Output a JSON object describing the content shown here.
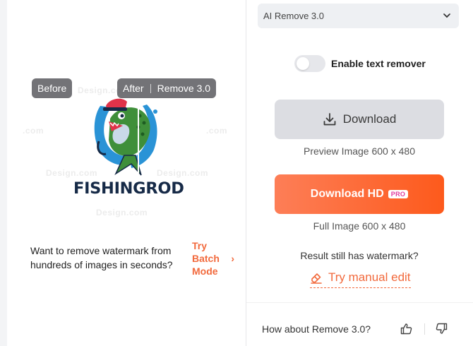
{
  "left": {
    "labels": {
      "before": "Before",
      "after": "After",
      "model": "Remove 3.0"
    },
    "logo_text": "FISHINGROD",
    "watermarks": [
      "Design.com",
      ".com",
      ".com",
      "Design.com",
      "Design.com",
      "Design.com"
    ],
    "promo_text": "Want to remove watermark from hundreds of images in seconds?",
    "batch_link": "Try Batch Mode",
    "batch_chevron": "›"
  },
  "right": {
    "model_select": {
      "value": "AI Remove 3.0",
      "chevron": "⌄"
    },
    "text_remover": {
      "label": "Enable text remover",
      "enabled": false
    },
    "download": {
      "label": "Download",
      "caption": "Preview Image 600 x 480"
    },
    "download_hd": {
      "label": "Download HD",
      "badge": "PRO",
      "caption": "Full Image 600 x 480"
    },
    "watermark_question": "Result still has watermark?",
    "manual_edit": "Try manual edit",
    "feedback_question": "How about Remove 3.0?"
  },
  "colors": {
    "accent": "#f26a3d",
    "hd_gradient_start": "#fd7e57",
    "hd_gradient_end": "#fd5a1c",
    "logo_navy": "#162a47"
  },
  "icons": [
    "chevron-down-icon",
    "download-icon",
    "eraser-icon",
    "thumbs-up-icon",
    "thumbs-down-icon",
    "chevron-right-icon"
  ]
}
